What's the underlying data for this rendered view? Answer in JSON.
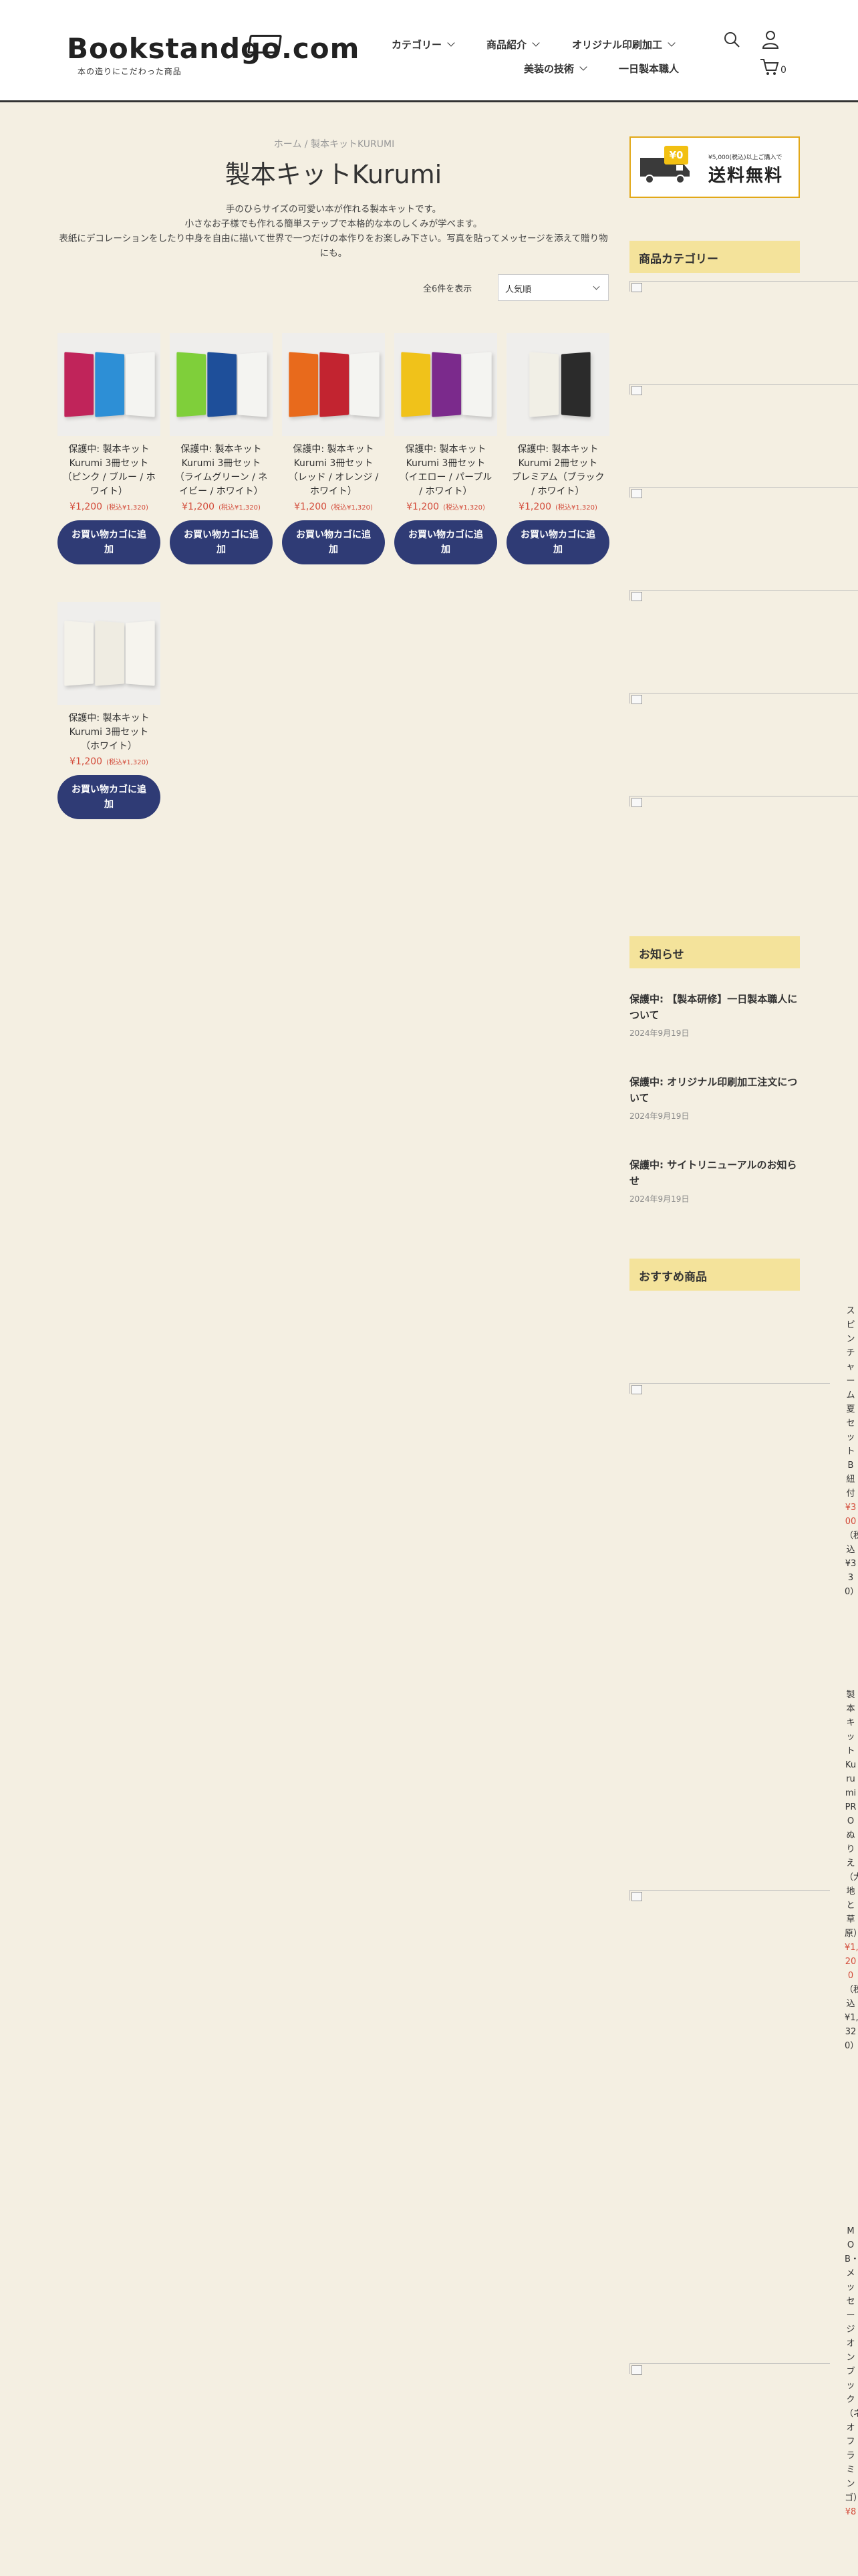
{
  "header": {
    "logo_text": "Bookstandgo.com",
    "logo_tagline": "本の造りにこだわった商品",
    "nav": [
      "カテゴリー",
      "商品紹介",
      "オリジナル印刷加工",
      "美装の技術",
      "一日製本職人"
    ],
    "cart_count": "0"
  },
  "breadcrumb": {
    "home": "ホーム",
    "sep": " / ",
    "current": "製本キットKURUMI"
  },
  "page_title": "製本キットKurumi",
  "description": [
    "手のひらサイズの可愛い本が作れる製本キットです。",
    "小さなお子様でも作れる簡単ステップで本格的な本のしくみが学べます。",
    "表紙にデコレーションをしたり中身を自由に描いて世界で一つだけの本作りをお楽しみ下さい。写真を貼ってメッセージを添えて贈り物にも。"
  ],
  "result_count": "全6件を表示",
  "sort_selected": "人気順",
  "products": [
    {
      "name": "保護中: 製本キット Kurumi 3冊セット（ピンク / ブルー / ホワイト）",
      "price": "¥1,200",
      "tax": "(税込¥1,320)",
      "button": "お買い物カゴに追加",
      "colors": [
        "#c0245a",
        "#2d8fd6",
        "#f4f4f1"
      ]
    },
    {
      "name": "保護中: 製本キット Kurumi 3冊セット（ライムグリーン / ネイビー / ホワイト）",
      "price": "¥1,200",
      "tax": "(税込¥1,320)",
      "button": "お買い物カゴに追加",
      "colors": [
        "#7fcf3a",
        "#1e4f9a",
        "#f4f4f1"
      ]
    },
    {
      "name": "保護中: 製本キット Kurumi 3冊セット（レッド / オレンジ / ホワイト）",
      "price": "¥1,200",
      "tax": "(税込¥1,320)",
      "button": "お買い物カゴに追加",
      "colors": [
        "#e86a1c",
        "#c22430",
        "#f4f4f1"
      ]
    },
    {
      "name": "保護中: 製本キット Kurumi 3冊セット（イエロー / パープル / ホワイト）",
      "price": "¥1,200",
      "tax": "(税込¥1,320)",
      "button": "お買い物カゴに追加",
      "colors": [
        "#f0c21a",
        "#7b2a8c",
        "#f4f4f1"
      ]
    },
    {
      "name": "保護中: 製本キット Kurumi 2冊セット　プレミアム（ブラック / ホワイト）",
      "price": "¥1,200",
      "tax": "(税込¥1,320)",
      "button": "お買い物カゴに追加",
      "colors": [
        "#f1efe6",
        "#2b2b2b"
      ]
    },
    {
      "name": "保護中: 製本キット Kurumi 3冊セット（ホワイト）",
      "price": "¥1,200",
      "tax": "(税込¥1,320)",
      "button": "お買い物カゴに追加",
      "colors": [
        "#f4f2ea",
        "#efece2",
        "#f6f4ee"
      ]
    }
  ],
  "sidebar": {
    "banner": {
      "small": "¥5,000(税込)以上ご購入で",
      "big": "送料無料",
      "chip": "¥0"
    },
    "category_heading": "商品カテゴリー",
    "news_heading": "お知らせ",
    "news": [
      {
        "title": "保護中: 【製本研修】一日製本職人について",
        "date": "2024年9月19日"
      },
      {
        "title": "保護中: オリジナル印刷加工注文について",
        "date": "2024年9月19日"
      },
      {
        "title": "保護中: サイトリニューアルのお知らせ",
        "date": "2024年9月19日"
      }
    ],
    "recommend_heading": "おすすめ商品",
    "recommended": [
      {
        "name": "スピンチャーム夏セットB紐付",
        "price": "¥300",
        "tax": "（税込¥330）"
      },
      {
        "name": "製本キットKurumi PROぬりえ（大地と草原）",
        "price": "¥1,200",
        "tax": "（税込¥1,320）"
      },
      {
        "name": "MOB・メッセージオンブック（ネオフラミンゴ）",
        "price": "¥8",
        "tax": ""
      }
    ]
  },
  "colors": {
    "accent": "#2f3b75",
    "price": "#d34b3a",
    "heading_bg": "#f4e39b",
    "page_bg": "#f4efe2"
  }
}
